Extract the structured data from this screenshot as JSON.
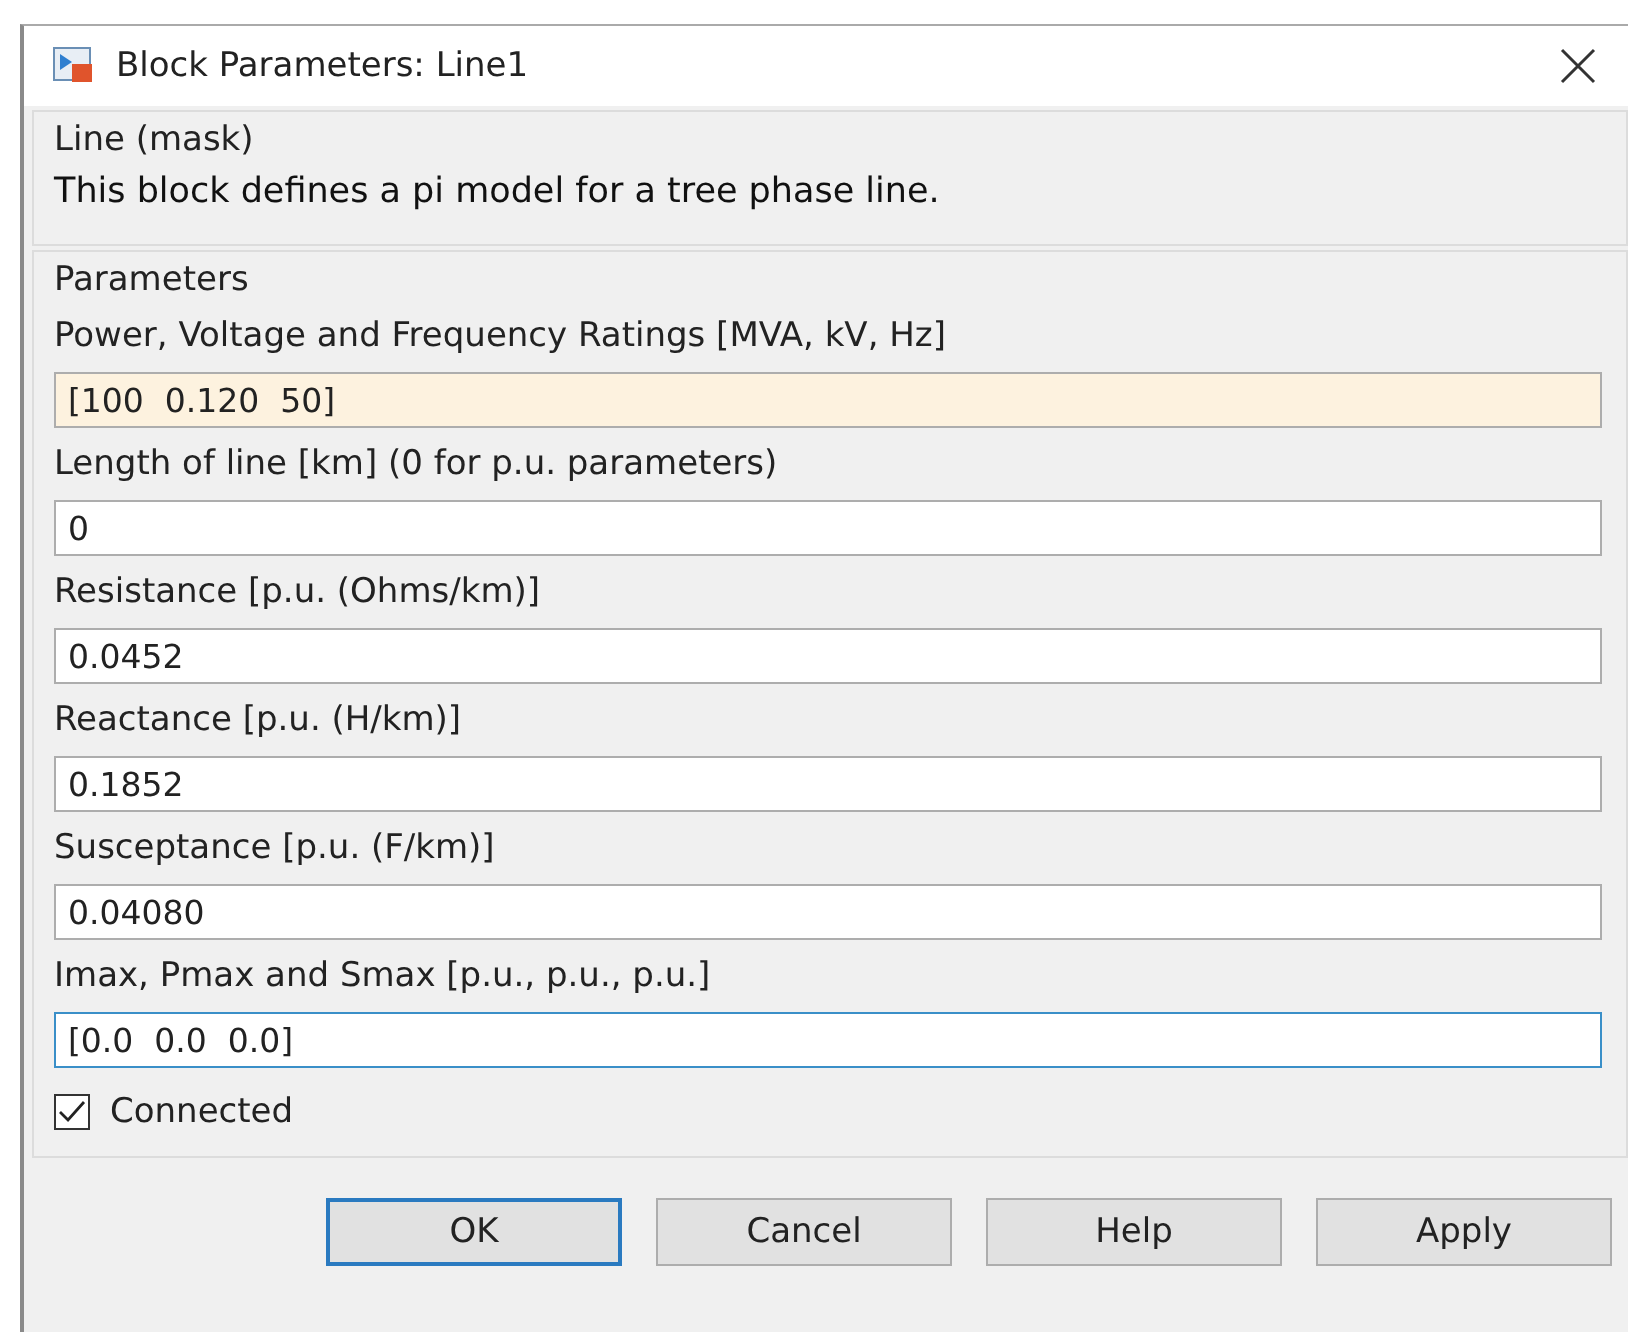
{
  "window": {
    "title": "Block Parameters: Line1"
  },
  "mask": {
    "title": "Line (mask)",
    "description": "This block defines a pi model for a tree phase line."
  },
  "parameters": {
    "title": "Parameters",
    "fields": [
      {
        "label": "Power, Voltage and Frequency Ratings [MVA, kV, Hz]",
        "value": "[100  0.120  50]",
        "highlighted": true,
        "focused": false
      },
      {
        "label": "Length of line [km] (0 for p.u. parameters)",
        "value": "0",
        "highlighted": false,
        "focused": false
      },
      {
        "label": "Resistance [p.u. (Ohms/km)]",
        "value": "0.0452",
        "highlighted": false,
        "focused": false
      },
      {
        "label": "Reactance [p.u. (H/km)]",
        "value": "0.1852",
        "highlighted": false,
        "focused": false
      },
      {
        "label": "Susceptance [p.u. (F/km)]",
        "value": "0.04080",
        "highlighted": false,
        "focused": false
      },
      {
        "label": "Imax, Pmax and Smax [p.u., p.u., p.u.]",
        "value": "[0.0  0.0  0.0]",
        "highlighted": false,
        "focused": true
      }
    ],
    "checkbox": {
      "label": "Connected",
      "checked": true
    }
  },
  "buttons": [
    {
      "label": "OK",
      "selected": true
    },
    {
      "label": "Cancel",
      "selected": false
    },
    {
      "label": "Help",
      "selected": false
    },
    {
      "label": "Apply",
      "selected": false
    }
  ]
}
